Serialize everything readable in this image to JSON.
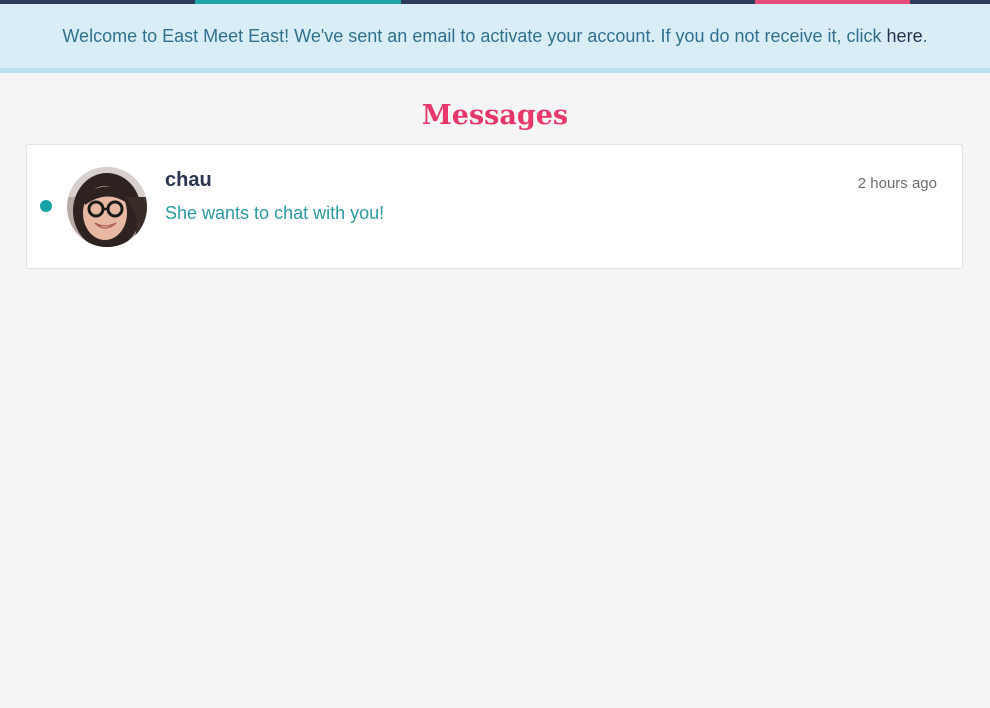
{
  "banner": {
    "text": "Welcome to East Meet East! We've sent an email to activate your account. If you do not receive it, click ",
    "link_label": "here",
    "suffix": "."
  },
  "page": {
    "title": "Messages"
  },
  "messages": [
    {
      "sender": "chau",
      "preview": "She wants to chat with you!",
      "time": "2 hours ago",
      "unread": true
    }
  ],
  "colors": {
    "accent_pink": "#e8386b",
    "accent_teal": "#16a3a6",
    "nav_dark": "#2f3d5a",
    "banner_bg": "#d9edf7"
  }
}
